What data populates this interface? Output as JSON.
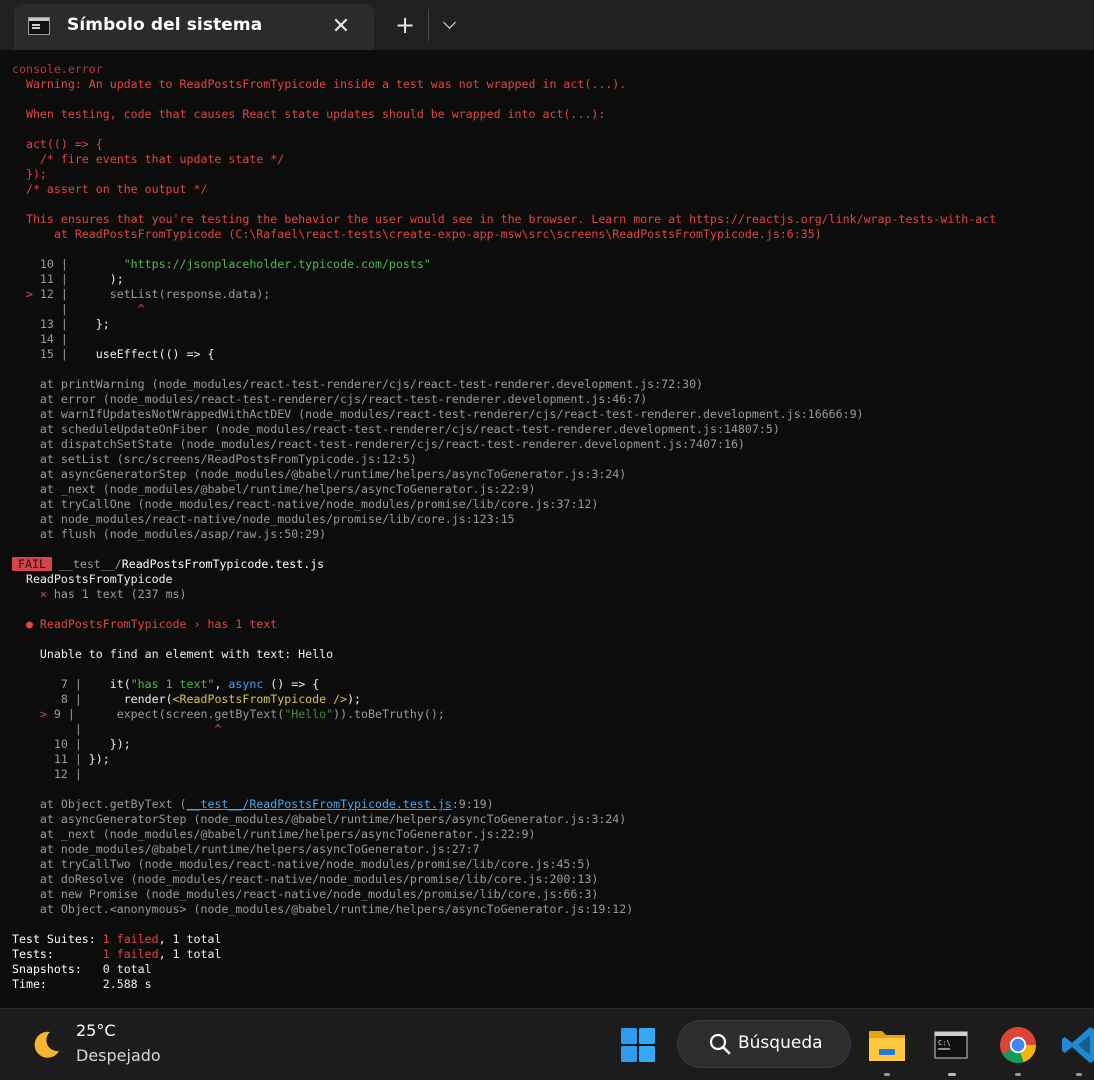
{
  "window": {
    "tab_title": "Símbolo del sistema",
    "close_glyph": "✕",
    "new_tab_glyph": "+"
  },
  "console": {
    "header": "console.error",
    "warning": "  Warning: An update to ReadPostsFromTypicode inside a test was not wrapped in act(...).",
    "when_testing": "  When testing, code that causes React state updates should be wrapped into act(...):",
    "act_1": "  act(() => {",
    "act_2": "    /* fire events that update state */",
    "act_3": "  });",
    "act_4": "  /* assert on the output */",
    "ensures": "  This ensures that you're testing the behavior the user would see in the browser. Learn more at https://reactjs.org/link/wrap-tests-with-act",
    "at_component": "      at ReadPostsFromTypicode (C:\\Rafael\\react-tests\\create-expo-app-msw\\src\\screens\\ReadPostsFromTypicode.js:6:35)"
  },
  "snippet1": {
    "l10_num": "    10 |",
    "l10_str": "\"https://jsonplaceholder.typicode.com/posts\"",
    "l11_num": "    11 |",
    "l11_code": "      );",
    "l12_marker": "  >",
    "l12_num": " 12 |",
    "l12_code": "      setList(response.data);",
    "caret_bar": "       |",
    "caret": "^",
    "l13_num": "    13 |",
    "l13_code": "    };",
    "l14_num": "    14 |",
    "l15_num": "    15 |",
    "l15_code": "    useEffect(() => {"
  },
  "stack1": [
    "    at printWarning (node_modules/react-test-renderer/cjs/react-test-renderer.development.js:72:30)",
    "    at error (node_modules/react-test-renderer/cjs/react-test-renderer.development.js:46:7)",
    "    at warnIfUpdatesNotWrappedWithActDEV (node_modules/react-test-renderer/cjs/react-test-renderer.development.js:16666:9)",
    "    at scheduleUpdateOnFiber (node_modules/react-test-renderer/cjs/react-test-renderer.development.js:14807:5)",
    "    at dispatchSetState (node_modules/react-test-renderer/cjs/react-test-renderer.development.js:7407:16)",
    "    at setList (src/screens/ReadPostsFromTypicode.js:12:5)",
    "    at asyncGeneratorStep (node_modules/@babel/runtime/helpers/asyncToGenerator.js:3:24)",
    "    at _next (node_modules/@babel/runtime/helpers/asyncToGenerator.js:22:9)",
    "    at tryCallOne (node_modules/react-native/node_modules/promise/lib/core.js:37:12)",
    "    at node_modules/react-native/node_modules/promise/lib/core.js:123:15",
    "    at flush (node_modules/asap/raw.js:50:29)"
  ],
  "result": {
    "fail_badge": "FAIL",
    "test_dir": " __test__/",
    "test_file": "ReadPostsFromTypicode.test.js",
    "describe": "  ReadPostsFromTypicode",
    "test_x": "    ×",
    "test_name": " has 1 text (237 ms)",
    "bullet_title": "  ● ReadPostsFromTypicode › has 1 text",
    "unable": "    Unable to find an element with text: Hello"
  },
  "snippet2": {
    "l7_num": "       7 |",
    "l7_it": "    it(",
    "l7_str": "\"has 1 text\"",
    "l7_comma": ", ",
    "l7_async": "async",
    "l7_rest": " () => {",
    "l8_num": "       8 |",
    "l8_pre": "      render(",
    "l8_jsx": "<ReadPostsFromTypicode />",
    "l8_post": ");",
    "l9_marker": "    >",
    "l9_num": " 9 |",
    "l9_pre": "      expect(screen.getByText(",
    "l9_str": "\"Hello\"",
    "l9_post": ")).toBeTruthy();",
    "caret_bar": "         |",
    "caret": "^",
    "l10_num": "      10 |",
    "l10_code": "    });",
    "l11_num": "      11 |",
    "l11_code": " });",
    "l12_num": "      12 |"
  },
  "stack2": {
    "first_pre": "    at Object.getByText (",
    "first_link": "__test__/ReadPostsFromTypicode.test.js",
    "first_post": ":9:19)",
    "rest": [
      "    at asyncGeneratorStep (node_modules/@babel/runtime/helpers/asyncToGenerator.js:3:24)",
      "    at _next (node_modules/@babel/runtime/helpers/asyncToGenerator.js:22:9)",
      "    at node_modules/@babel/runtime/helpers/asyncToGenerator.js:27:7",
      "    at tryCallTwo (node_modules/react-native/node_modules/promise/lib/core.js:45:5)",
      "    at doResolve (node_modules/react-native/node_modules/promise/lib/core.js:200:13)",
      "    at new Promise (node_modules/react-native/node_modules/promise/lib/core.js:66:3)",
      "    at Object.<anonymous> (node_modules/@babel/runtime/helpers/asyncToGenerator.js:19:12)"
    ]
  },
  "summary": {
    "suites_label": "Test Suites: ",
    "suites_failed": "1 failed",
    "suites_total": ", 1 total",
    "tests_label": "Tests:       ",
    "tests_failed": "1 failed",
    "tests_total": ", 1 total",
    "snapshots_label": "Snapshots:   ",
    "snapshots_value": "0 total",
    "time_label": "Time:        ",
    "time_value": "2.588 s"
  },
  "taskbar": {
    "weather_temp": "25°C",
    "weather_desc": "Despejado",
    "search_label": "Búsqueda",
    "weather_icon": "moon-icon",
    "apps": [
      "file-explorer-icon",
      "terminal-icon",
      "chrome-icon",
      "vscode-icon"
    ]
  }
}
